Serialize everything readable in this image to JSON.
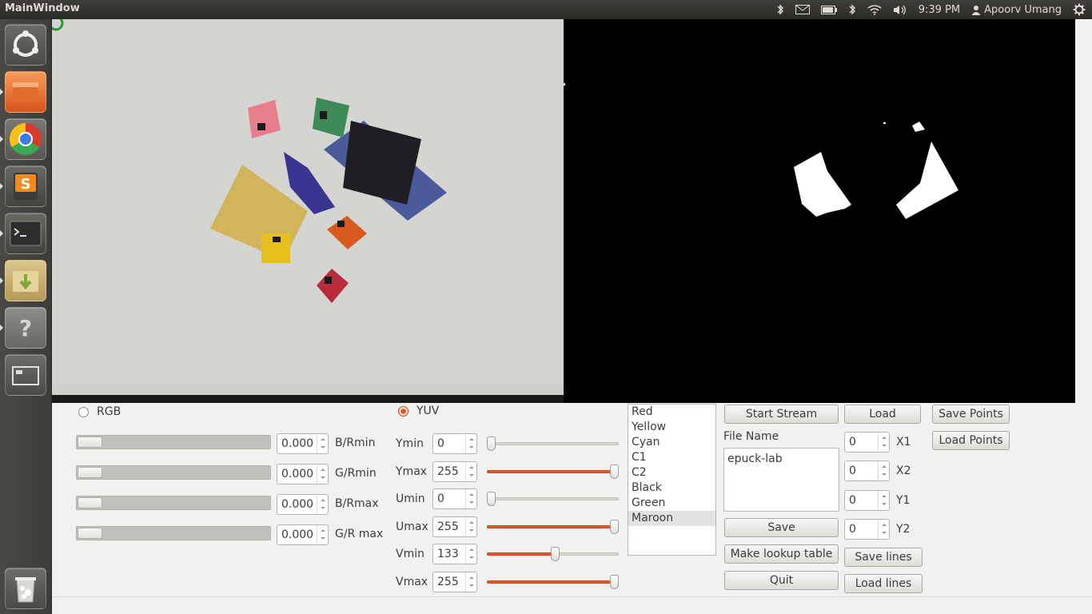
{
  "window": {
    "title": "MainWindow"
  },
  "tray": {
    "time": "9:39 PM",
    "user": "Apoorv Umang"
  },
  "launcher": {
    "items": [
      "ubuntu-dash",
      "files",
      "chrome",
      "sublime-text",
      "terminal",
      "archive-manager",
      "help",
      "workspace-switcher",
      "trash"
    ]
  },
  "rgb": {
    "label": "RGB",
    "rows": [
      {
        "value": "0.000",
        "label": "B/Rmin"
      },
      {
        "value": "0.000",
        "label": "G/Rmin"
      },
      {
        "value": "0.000",
        "label": "B/Rmax"
      },
      {
        "value": "0.000",
        "label": "G/R max"
      }
    ]
  },
  "yuv": {
    "label": "YUV",
    "rows": [
      {
        "label": "Ymin",
        "value": "0",
        "level": 0
      },
      {
        "label": "Ymax",
        "value": "255",
        "level": 1.0
      },
      {
        "label": "Umin",
        "value": "0",
        "level": 0
      },
      {
        "label": "Umax",
        "value": "255",
        "level": 1.0
      },
      {
        "label": "Vmin",
        "value": "133",
        "level": 0.52
      },
      {
        "label": "Vmax",
        "value": "255",
        "level": 1.0
      }
    ]
  },
  "colors": {
    "items": [
      "Red",
      "Yellow",
      "Cyan",
      "C1",
      "C2",
      "Black",
      "Green",
      "Maroon"
    ],
    "selected": "Maroon"
  },
  "file": {
    "label": "File Name",
    "value": "epuck-lab"
  },
  "buttons": {
    "start_stream": "Start Stream",
    "save": "Save",
    "make_lookup": "Make lookup table",
    "quit": "Quit",
    "load": "Load",
    "save_points": "Save Points",
    "load_points": "Load Points",
    "save_lines": "Save lines",
    "load_lines": "Load lines"
  },
  "coords": [
    {
      "value": "0",
      "label": "X1"
    },
    {
      "value": "0",
      "label": "X2"
    },
    {
      "value": "0",
      "label": "Y1"
    },
    {
      "value": "0",
      "label": "Y2"
    }
  ]
}
